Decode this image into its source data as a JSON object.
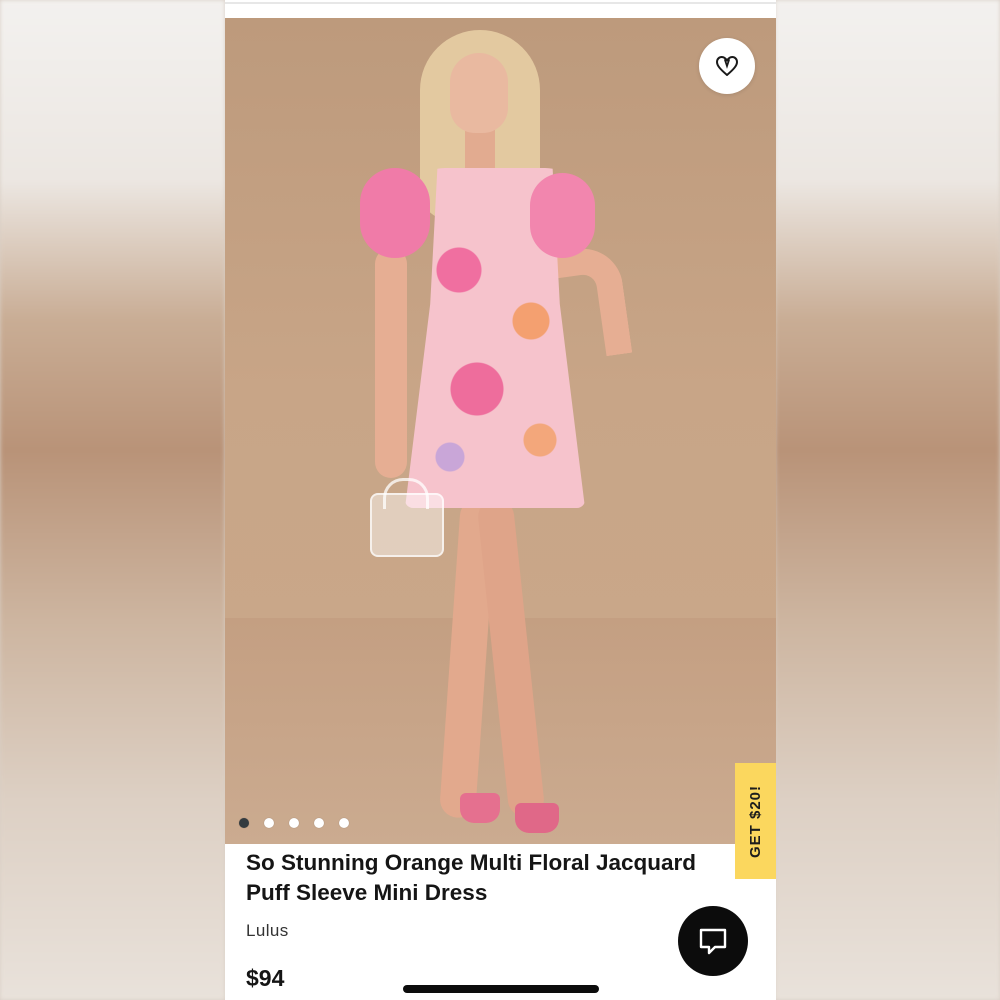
{
  "product": {
    "title_line1": "So Stunning Orange Multi Floral Jacquard",
    "title_line2": "Puff Sleeve Mini Dress",
    "brand": "Lulus",
    "price": "$94",
    "image_description_icon": "product-photo"
  },
  "carousel": {
    "total_images": 5,
    "active_index": 0
  },
  "promo": {
    "label": "GET $20!",
    "color": "#fbd75e"
  },
  "icons": {
    "favorite": "heart-icon",
    "chat": "chat-bubble-icon"
  },
  "colors": {
    "chat_button": "#0c0c0c",
    "active_dot": "#333b40",
    "photo_background": "#c8a587"
  }
}
